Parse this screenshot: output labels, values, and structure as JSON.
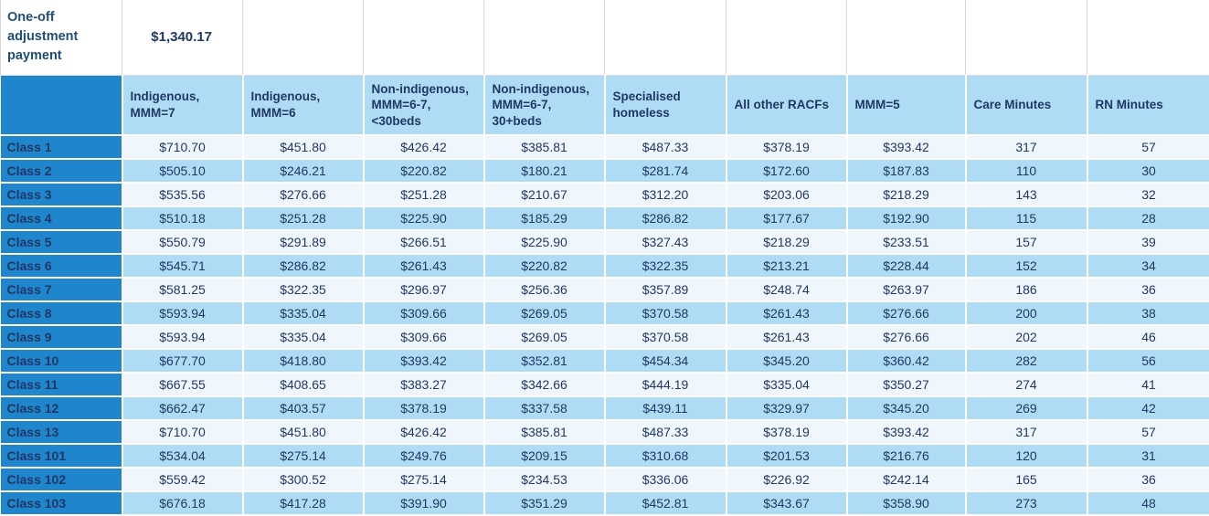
{
  "title": {
    "label": "One-off adjustment payment",
    "value": "$1,340.17"
  },
  "columns": [
    {
      "key": "class",
      "label": ""
    },
    {
      "key": "indigenous_mmm7",
      "label": "Indigenous, MMM=7"
    },
    {
      "key": "indigenous_mmm6",
      "label": "Indigenous, MMM=6"
    },
    {
      "key": "nonindig_mmm67_lt30",
      "label": "Non-indigenous, MMM=6-7, <30beds"
    },
    {
      "key": "nonindig_mmm67_30plus",
      "label": "Non-indigenous, MMM=6-7, 30+beds"
    },
    {
      "key": "specialised_homeless",
      "label": "Specialised homeless"
    },
    {
      "key": "all_other_racfs",
      "label": "All other RACFs"
    },
    {
      "key": "mmm5",
      "label": "MMM=5"
    },
    {
      "key": "care_minutes",
      "label": "Care Minutes"
    },
    {
      "key": "rn_minutes",
      "label": "RN Minutes"
    }
  ],
  "rows": [
    {
      "class": "Class 1",
      "cells": [
        "$710.70",
        "$451.80",
        "$426.42",
        "$385.81",
        "$487.33",
        "$378.19",
        "$393.42",
        "317",
        "57"
      ]
    },
    {
      "class": "Class 2",
      "cells": [
        "$505.10",
        "$246.21",
        "$220.82",
        "$180.21",
        "$281.74",
        "$172.60",
        "$187.83",
        "110",
        "30"
      ]
    },
    {
      "class": "Class 3",
      "cells": [
        "$535.56",
        "$276.66",
        "$251.28",
        "$210.67",
        "$312.20",
        "$203.06",
        "$218.29",
        "143",
        "32"
      ]
    },
    {
      "class": "Class 4",
      "cells": [
        "$510.18",
        "$251.28",
        "$225.90",
        "$185.29",
        "$286.82",
        "$177.67",
        "$192.90",
        "115",
        "28"
      ]
    },
    {
      "class": "Class 5",
      "cells": [
        "$550.79",
        "$291.89",
        "$266.51",
        "$225.90",
        "$327.43",
        "$218.29",
        "$233.51",
        "157",
        "39"
      ]
    },
    {
      "class": "Class 6",
      "cells": [
        "$545.71",
        "$286.82",
        "$261.43",
        "$220.82",
        "$322.35",
        "$213.21",
        "$228.44",
        "152",
        "34"
      ]
    },
    {
      "class": "Class 7",
      "cells": [
        "$581.25",
        "$322.35",
        "$296.97",
        "$256.36",
        "$357.89",
        "$248.74",
        "$263.97",
        "186",
        "36"
      ]
    },
    {
      "class": "Class 8",
      "cells": [
        "$593.94",
        "$335.04",
        "$309.66",
        "$269.05",
        "$370.58",
        "$261.43",
        "$276.66",
        "200",
        "38"
      ]
    },
    {
      "class": "Class 9",
      "cells": [
        "$593.94",
        "$335.04",
        "$309.66",
        "$269.05",
        "$370.58",
        "$261.43",
        "$276.66",
        "202",
        "46"
      ]
    },
    {
      "class": "Class 10",
      "cells": [
        "$677.70",
        "$418.80",
        "$393.42",
        "$352.81",
        "$454.34",
        "$345.20",
        "$360.42",
        "282",
        "56"
      ]
    },
    {
      "class": "Class 11",
      "cells": [
        "$667.55",
        "$408.65",
        "$383.27",
        "$342.66",
        "$444.19",
        "$335.04",
        "$350.27",
        "274",
        "41"
      ]
    },
    {
      "class": "Class 12",
      "cells": [
        "$662.47",
        "$403.57",
        "$378.19",
        "$337.58",
        "$439.11",
        "$329.97",
        "$345.20",
        "269",
        "42"
      ]
    },
    {
      "class": "Class 13",
      "cells": [
        "$710.70",
        "$451.80",
        "$426.42",
        "$385.81",
        "$487.33",
        "$378.19",
        "$393.42",
        "317",
        "57"
      ]
    },
    {
      "class": "Class 101",
      "cells": [
        "$534.04",
        "$275.14",
        "$249.76",
        "$209.15",
        "$310.68",
        "$201.53",
        "$216.76",
        "120",
        "31"
      ]
    },
    {
      "class": "Class 102",
      "cells": [
        "$559.42",
        "$300.52",
        "$275.14",
        "$234.53",
        "$336.06",
        "$226.92",
        "$242.14",
        "165",
        "36"
      ]
    },
    {
      "class": "Class 103",
      "cells": [
        "$676.18",
        "$417.28",
        "$391.90",
        "$351.29",
        "$452.81",
        "$343.67",
        "$358.90",
        "273",
        "48"
      ]
    }
  ],
  "colors": {
    "header_band": "#aedcf5",
    "row_label": "#1f86cd",
    "row_odd": "#eff7fc",
    "row_even": "#aedcf5",
    "text_dark": "#1f3864",
    "title_text": "#1f4e79"
  }
}
